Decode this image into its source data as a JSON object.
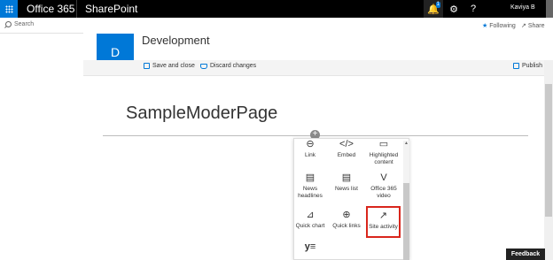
{
  "suitebar": {
    "brand": "Office 365",
    "app": "SharePoint",
    "notification_count": "1",
    "help": "?",
    "user": "Kaviya B"
  },
  "search": {
    "placeholder": "Search"
  },
  "toplinks": {
    "following": "Following",
    "share": "Share"
  },
  "site": {
    "initial": "D",
    "title": "Development"
  },
  "commandbar": {
    "save": "Save and close",
    "discard": "Discard changes",
    "publish": "Publish"
  },
  "page": {
    "title": "SampleModerPage"
  },
  "add_icon": "+",
  "toolbox": {
    "items": [
      {
        "label": "Link",
        "icon": "link-icon",
        "glyph": "⊖"
      },
      {
        "label": "Embed",
        "icon": "embed-icon",
        "glyph": "</>"
      },
      {
        "label": "Highlighted content",
        "icon": "highlighted-content-icon",
        "glyph": "▭"
      },
      {
        "label": "News headlines",
        "icon": "news-headlines-icon",
        "glyph": "▤"
      },
      {
        "label": "News list",
        "icon": "news-list-icon",
        "glyph": "▤"
      },
      {
        "label": "Office 365 video",
        "icon": "office-365-video-icon",
        "glyph": "V"
      },
      {
        "label": "Quick chart",
        "icon": "quick-chart-icon",
        "glyph": "⊿"
      },
      {
        "label": "Quick links",
        "icon": "quick-links-icon",
        "glyph": "⊕"
      },
      {
        "label": "Site activity",
        "icon": "site-activity-icon",
        "glyph": "↗"
      },
      {
        "label": "",
        "icon": "yammer-icon",
        "glyph": "y≡"
      }
    ],
    "selected": "Site activity",
    "selected_color": "#d9261c"
  },
  "feedback": "Feedback",
  "colors": {
    "accent": "#0078d7",
    "suitebar": "#000000"
  }
}
